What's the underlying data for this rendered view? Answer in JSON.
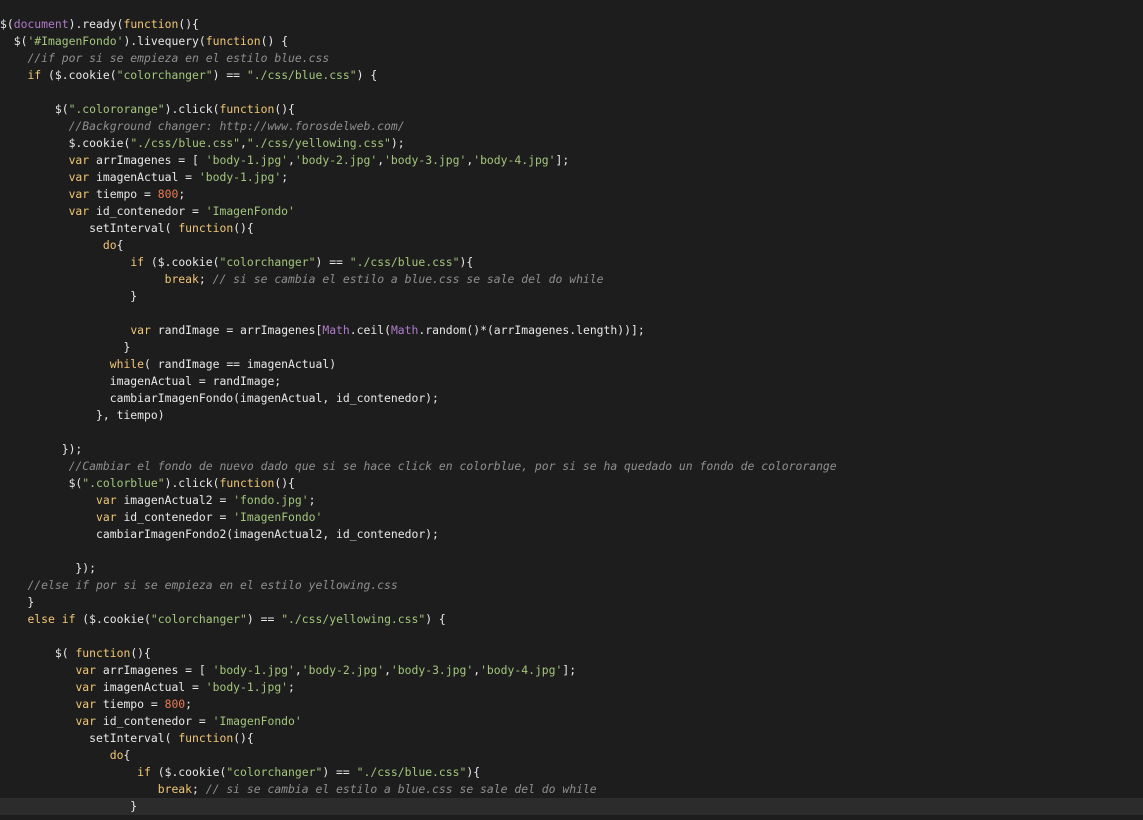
{
  "editor": {
    "language": "javascript",
    "current_line": 46,
    "colors": {
      "background": "#1d1d1d",
      "current_line": "#2c2c2c",
      "text": "#e8e8e8",
      "keyword": "#f0c674",
      "string": "#a3c67c",
      "comment": "#8f8f8f",
      "number": "#ea7a52",
      "builtin": "#b07ac9"
    },
    "lines": [
      "$(document).ready(function(){",
      "  $('#ImagenFondo').livequery(function() {",
      "    //if por si se empieza en el estilo blue.css",
      "    if ($.cookie(\"colorchanger\") == \"./css/blue.css\") {",
      "",
      "        $(\".colororange\").click(function(){",
      "          //Background changer: http://www.forosdelweb.com/",
      "          $.cookie(\"./css/blue.css\",\"./css/yellowing.css\");",
      "          var arrImagenes = [ 'body-1.jpg','body-2.jpg','body-3.jpg','body-4.jpg'];",
      "          var imagenActual = 'body-1.jpg';",
      "          var tiempo = 800;",
      "          var id_contenedor = 'ImagenFondo'",
      "             setInterval( function(){",
      "               do{",
      "                   if ($.cookie(\"colorchanger\") == \"./css/blue.css\"){",
      "                        break; // si se cambia el estilo a blue.css se sale del do while",
      "                   }",
      "",
      "                   var randImage = arrImagenes[Math.ceil(Math.random()*(arrImagenes.length))];",
      "                  }",
      "                while( randImage == imagenActual)",
      "                imagenActual = randImage;",
      "                cambiarImagenFondo(imagenActual, id_contenedor);",
      "              }, tiempo)",
      "",
      "         });",
      "          //Cambiar el fondo de nuevo dado que si se hace click en colorblue, por si se ha quedado un fondo de colororange",
      "          $(\".colorblue\").click(function(){",
      "              var imagenActual2 = 'fondo.jpg';",
      "              var id_contenedor = 'ImagenFondo'",
      "              cambiarImagenFondo2(imagenActual2, id_contenedor);",
      "",
      "           });",
      "    //else if por si se empieza en el estilo yellowing.css",
      "    }",
      "    else if ($.cookie(\"colorchanger\") == \"./css/yellowing.css\") {",
      "",
      "        $( function(){",
      "           var arrImagenes = [ 'body-1.jpg','body-2.jpg','body-3.jpg','body-4.jpg'];",
      "           var imagenActual = 'body-1.jpg';",
      "           var tiempo = 800;",
      "           var id_contenedor = 'ImagenFondo'",
      "             setInterval( function(){",
      "                do{",
      "                    if ($.cookie(\"colorchanger\") == \"./css/blue.css\"){",
      "                       break; // si se cambia el estilo a blue.css se sale del do while",
      "                   }"
    ]
  }
}
